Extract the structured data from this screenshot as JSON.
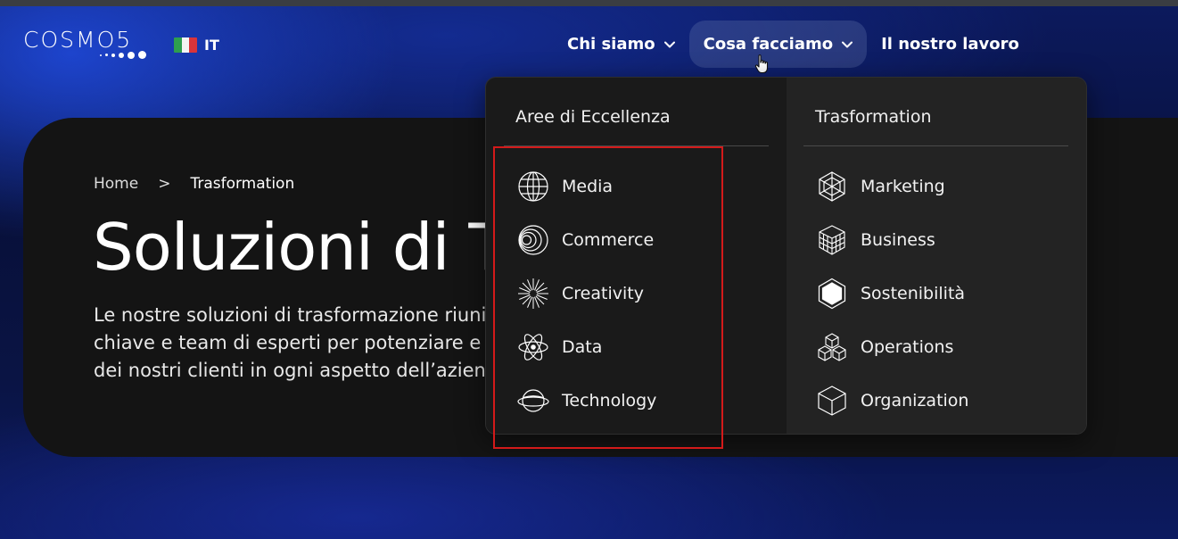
{
  "brand": {
    "logo_text": "COSMO5"
  },
  "language": {
    "code": "IT"
  },
  "nav": {
    "items": [
      {
        "label": "Chi siamo",
        "has_dropdown": true,
        "active": false
      },
      {
        "label": "Cosa facciamo",
        "has_dropdown": true,
        "active": true
      },
      {
        "label": "Il nostro lavoro",
        "has_dropdown": false,
        "active": false
      }
    ]
  },
  "breadcrumb": {
    "home": "Home",
    "separator": ">",
    "current": "Trasformation"
  },
  "hero": {
    "title": "Soluzioni di Tr",
    "description_lines": [
      "Le nostre soluzioni di trasformazione riunis",
      "chiave e team di esperti per potenziare e m",
      "dei nostri clienti in ogni aspetto dell’azienda"
    ]
  },
  "dropdown": {
    "left": {
      "title": "Aree di Eccellenza",
      "items": [
        {
          "label": "Media",
          "icon": "globe-icon"
        },
        {
          "label": "Commerce",
          "icon": "rings-icon"
        },
        {
          "label": "Creativity",
          "icon": "starburst-icon"
        },
        {
          "label": "Data",
          "icon": "atom-icon"
        },
        {
          "label": "Technology",
          "icon": "planet-icon"
        }
      ]
    },
    "right": {
      "title": "Trasformation",
      "items": [
        {
          "label": "Marketing",
          "icon": "hexagon-wire-icon"
        },
        {
          "label": "Business",
          "icon": "cube-grid-icon"
        },
        {
          "label": "Sostenibilità",
          "icon": "hexagon-solid-icon"
        },
        {
          "label": "Operations",
          "icon": "cubes-stack-icon"
        },
        {
          "label": "Organization",
          "icon": "cube-icon"
        }
      ]
    }
  },
  "colors": {
    "highlight": "#d31a1a",
    "panel_left": "#1a1a1a",
    "panel_right": "#232323",
    "hero_card": "#141414"
  }
}
